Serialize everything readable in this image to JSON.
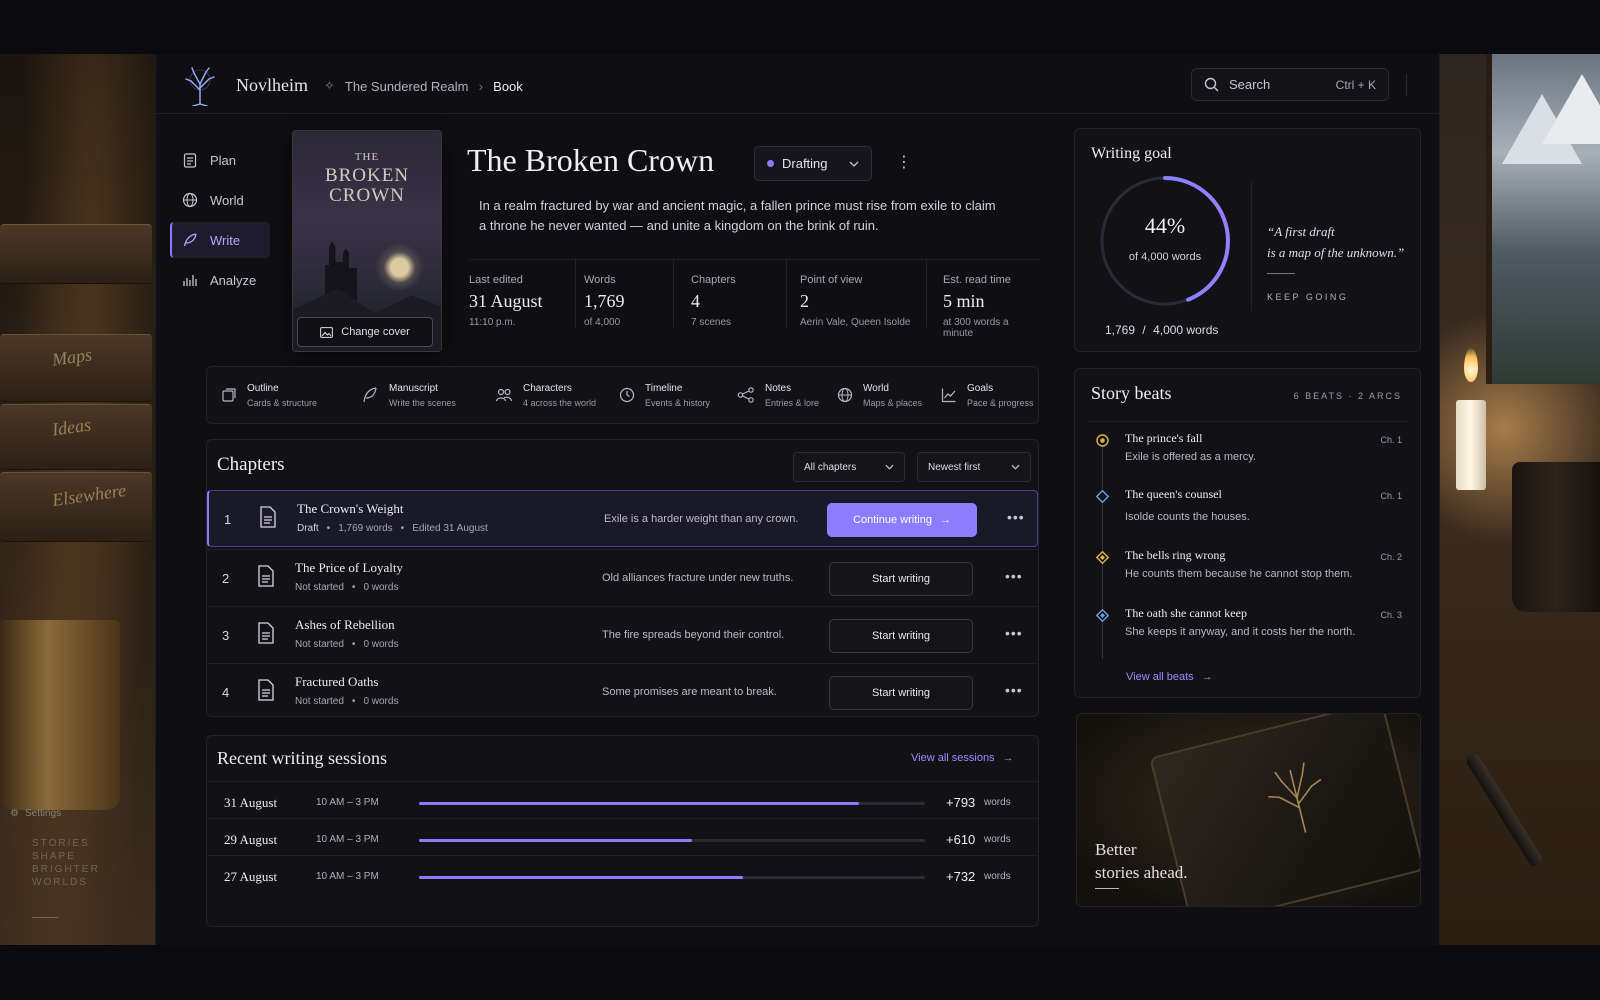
{
  "app": {
    "name": "Novlheim"
  },
  "breadcrumb": {
    "project": "The Sundered Realm",
    "current": "Book"
  },
  "search": {
    "placeholder": "Search",
    "shortcut": "Ctrl + K"
  },
  "nav": [
    {
      "label": "Plan",
      "icon": "clipboard-icon"
    },
    {
      "label": "World",
      "icon": "globe-icon"
    },
    {
      "label": "Write",
      "icon": "quill-icon",
      "active": true
    },
    {
      "label": "Analyze",
      "icon": "chart-hand-icon"
    }
  ],
  "left_panel": {
    "settings": "Settings",
    "motto": [
      "STORIES",
      "SHAPE",
      "BRIGHTER",
      "WORLDS"
    ]
  },
  "book": {
    "cover_line1": "THE",
    "cover_line2": "BROKEN",
    "cover_line3": "CROWN",
    "change_cover": "Change cover",
    "title": "The Broken Crown",
    "status": "Drafting",
    "synopsis": "In a realm fractured by war and ancient magic, a fallen prince must rise from exile to claim a throne he never wanted — and unite a kingdom on the brink of ruin."
  },
  "stats": [
    {
      "label": "Last edited",
      "value": "31 August",
      "sub": "11:10 p.m."
    },
    {
      "label": "Words",
      "value": "1,769",
      "sub": "of 4,000"
    },
    {
      "label": "Chapters",
      "value": "4",
      "sub": "7 scenes"
    },
    {
      "label": "Point of view",
      "value": "2",
      "sub": "Aerin Vale, Queen Isolde"
    },
    {
      "label": "Est. read time",
      "value": "5 min",
      "sub": "at 300 words a minute"
    }
  ],
  "tools": [
    {
      "title": "Outline",
      "sub": "Cards & structure",
      "icon": "cards-icon"
    },
    {
      "title": "Manuscript",
      "sub": "Write the scenes",
      "icon": "feather-icon"
    },
    {
      "title": "Characters",
      "sub": "4 across the world",
      "icon": "people-icon"
    },
    {
      "title": "Timeline",
      "sub": "Events & history",
      "icon": "clock-icon"
    },
    {
      "title": "Notes",
      "sub": "Entries & lore",
      "icon": "share-nodes-icon"
    },
    {
      "title": "World",
      "sub": "Maps & places",
      "icon": "globe-icon"
    },
    {
      "title": "Goals",
      "sub": "Pace & progress",
      "icon": "trend-icon"
    }
  ],
  "chapters": {
    "heading": "Chapters",
    "filter": "All chapters",
    "sort": "Newest first",
    "rows": [
      {
        "num": "1",
        "title": "The Crown's Weight",
        "status": "Draft",
        "words": "1,769 words",
        "edited": "Edited 31 August",
        "desc": "Exile is a harder weight than any crown.",
        "action": "Continue writing"
      },
      {
        "num": "2",
        "title": "The Price of Loyalty",
        "status": "Not started",
        "words": "0 words",
        "desc": "Old alliances fracture under new truths.",
        "action": "Start writing"
      },
      {
        "num": "3",
        "title": "Ashes of Rebellion",
        "status": "Not started",
        "words": "0 words",
        "desc": "The fire spreads beyond their control.",
        "action": "Start writing"
      },
      {
        "num": "4",
        "title": "Fractured Oaths",
        "status": "Not started",
        "words": "0 words",
        "desc": "Some promises are meant to break.",
        "action": "Start writing"
      }
    ]
  },
  "sessions": {
    "heading": "Recent writing sessions",
    "view_all": "View all sessions",
    "unit": "words",
    "rows": [
      {
        "date": "31 August",
        "time": "10 AM – 3 PM",
        "words": "+793",
        "fill": 0.87
      },
      {
        "date": "29 August",
        "time": "10 AM – 3 PM",
        "words": "+610",
        "fill": 0.54
      },
      {
        "date": "27 August",
        "time": "10 AM – 3 PM",
        "words": "+732",
        "fill": 0.64
      }
    ]
  },
  "goal": {
    "heading": "Writing goal",
    "percent": "44%",
    "percent_value": 0.44,
    "of_text": "of 4,000 words",
    "current": "1,769",
    "slash": "/",
    "target": "4,000 words",
    "quote_line1": "“A first draft",
    "quote_line2": "is a map of the unknown.”",
    "keep": "KEEP GOING"
  },
  "beats": {
    "heading": "Story beats",
    "count": "6 BEATS · 2 ARCS",
    "view_all": "View all beats",
    "items": [
      {
        "title": "The prince's fall",
        "desc": "Exile is offered as a mercy.",
        "chapter": "Ch. 1",
        "mark": "circle",
        "color": "#e0b44c"
      },
      {
        "title": "The queen's counsel",
        "desc": "Isolde counts the houses.",
        "chapter": "Ch. 1",
        "mark": "diamond",
        "color": "#6b9de8"
      },
      {
        "title": "The bells ring wrong",
        "desc": "He counts them because he cannot stop them.",
        "chapter": "Ch. 2",
        "mark": "diamond",
        "color": "#e0b44c"
      },
      {
        "title": "The oath she cannot keep",
        "desc": "She keeps it anyway, and it costs her the north.",
        "chapter": "Ch. 3",
        "mark": "diamond",
        "color": "#6b9de8"
      }
    ]
  },
  "promo": {
    "line1": "Better",
    "line2": "stories ahead."
  },
  "colors": {
    "accent": "#8e7cff",
    "accent_text": "#9c8cff",
    "gold": "#e0b44c",
    "blue": "#6b9de8"
  }
}
